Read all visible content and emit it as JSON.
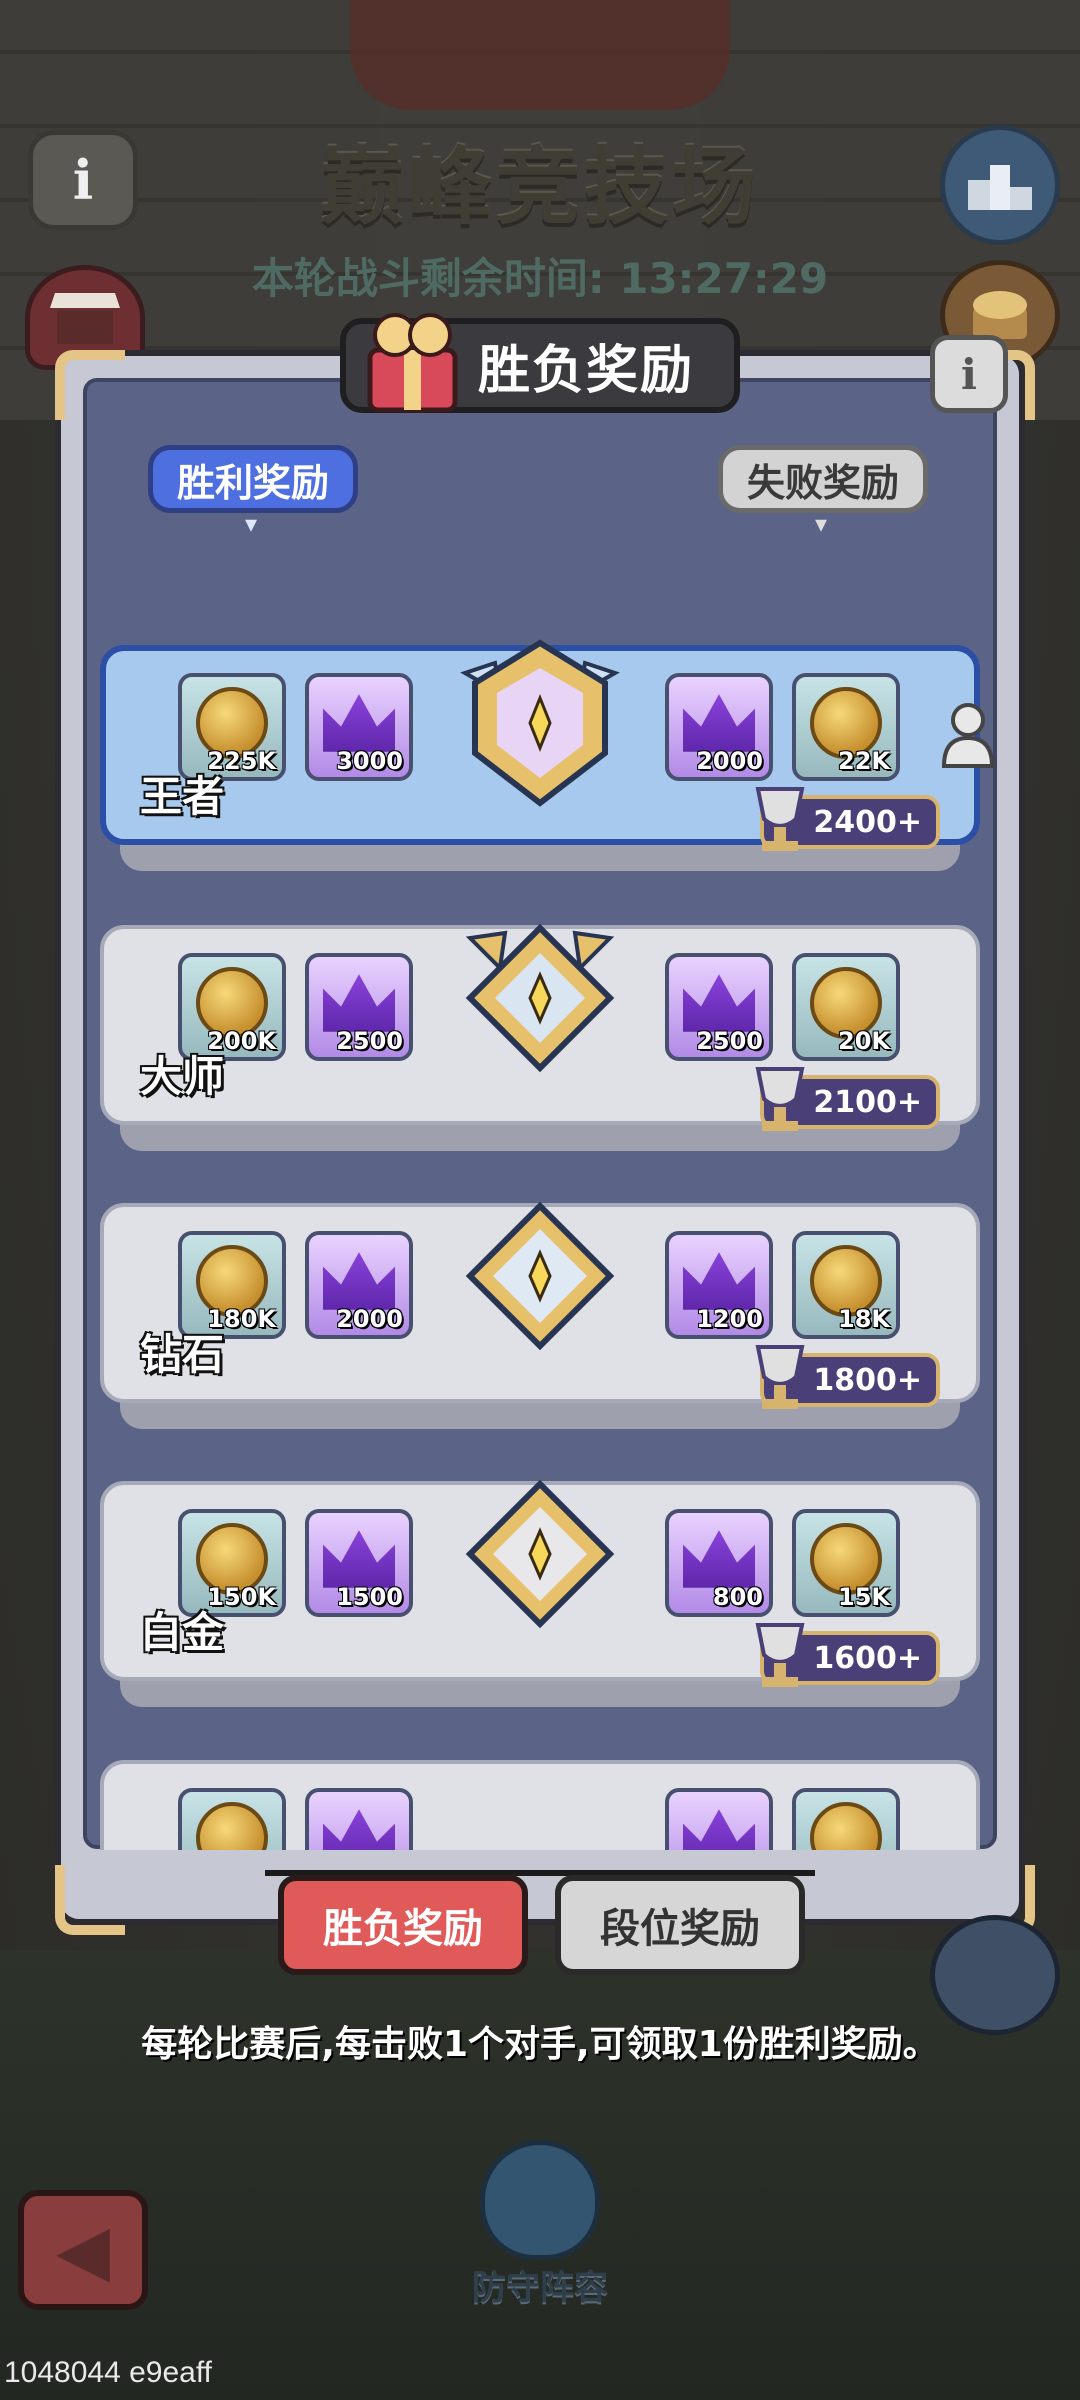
{
  "title": "巅峰竞技场",
  "timer_text": "本轮战斗剩余时间: 13:27:29",
  "panel_title": "胜负奖励",
  "subtabs": {
    "win": "胜利奖励",
    "lose": "失败奖励"
  },
  "tiers": [
    {
      "name": "王者",
      "win": [
        "225K",
        "3000"
      ],
      "lose": [
        "2000",
        "22K"
      ],
      "trophy": "2400+"
    },
    {
      "name": "大师",
      "win": [
        "200K",
        "2500"
      ],
      "lose": [
        "2500",
        "20K"
      ],
      "trophy": "2100+"
    },
    {
      "name": "钻石",
      "win": [
        "180K",
        "2000"
      ],
      "lose": [
        "1200",
        "18K"
      ],
      "trophy": "1800+"
    },
    {
      "name": "白金",
      "win": [
        "150K",
        "1500"
      ],
      "lose": [
        "800",
        "15K"
      ],
      "trophy": "1600+"
    }
  ],
  "bottom_tabs": {
    "result": "胜负奖励",
    "rank": "段位奖励"
  },
  "hint": "每轮比赛后,每击败1个对手,可领取1份胜利奖励。",
  "defense_label": "防守阵容",
  "footer_id": "1048044 e9eaff",
  "icons": {
    "info": "info-icon",
    "ranking": "podium-icon",
    "shop": "shop-icon",
    "chest": "chest-icon",
    "gift": "gift-icon",
    "coin": "coin-icon",
    "crown": "crown-icon",
    "trophy": "trophy-icon",
    "back": "back-arrow-icon",
    "shield": "shield-icon"
  },
  "colors": {
    "active_tab": "#e05a5a",
    "win_tab": "#4e6fe0",
    "panel": "#5b6386"
  }
}
